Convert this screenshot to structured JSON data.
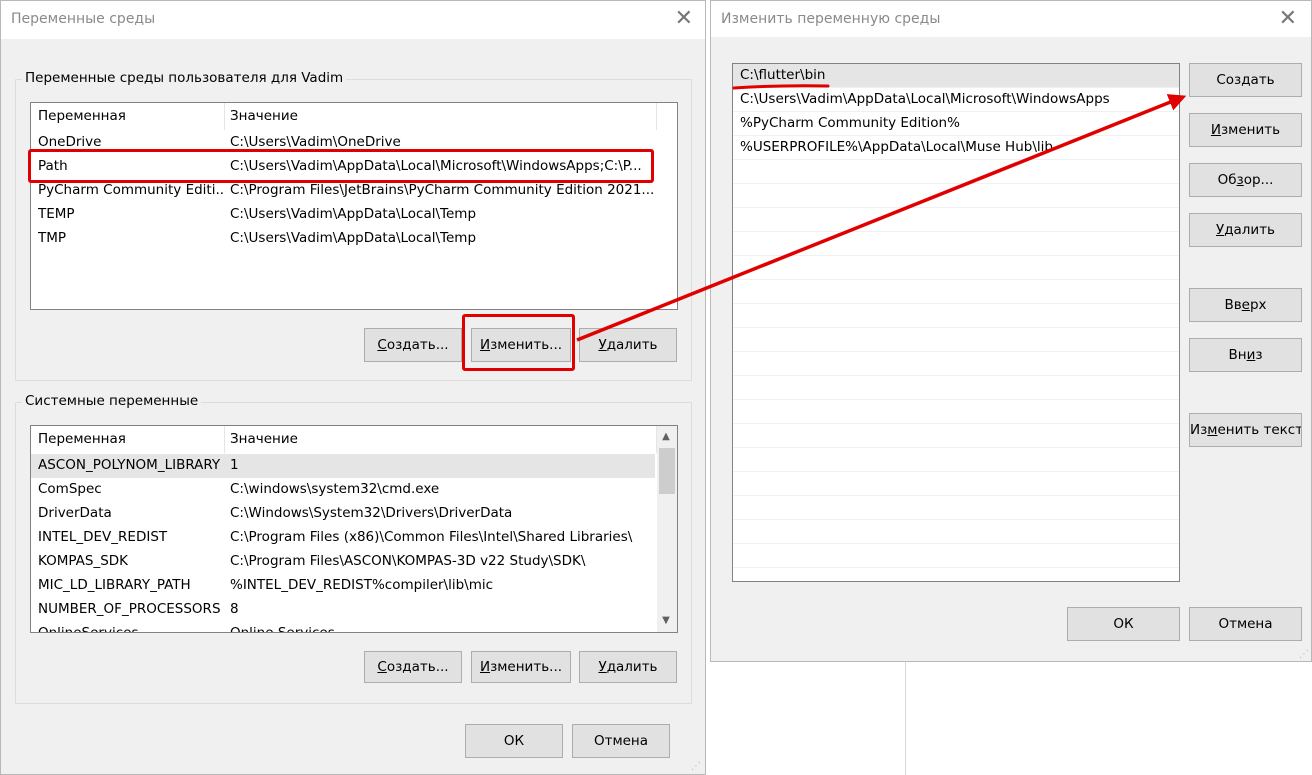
{
  "env_dialog": {
    "title": "Переменные среды",
    "user_group": {
      "legend": "Переменные среды пользователя для Vadim",
      "col_var": "Переменная",
      "col_val": "Значение",
      "rows": [
        {
          "name": "OneDrive",
          "value": "C:\\Users\\Vadim\\OneDrive"
        },
        {
          "name": "Path",
          "value": "C:\\Users\\Vadim\\AppData\\Local\\Microsoft\\WindowsApps;C:\\P..."
        },
        {
          "name": "PyCharm Community Editi...",
          "value": "C:\\Program Files\\JetBrains\\PyCharm Community Edition 2021..."
        },
        {
          "name": "TEMP",
          "value": "C:\\Users\\Vadim\\AppData\\Local\\Temp"
        },
        {
          "name": "TMP",
          "value": "C:\\Users\\Vadim\\AppData\\Local\\Temp"
        }
      ],
      "btn_create_u": "С",
      "btn_create_rest": "оздать...",
      "btn_edit_u": "И",
      "btn_edit_rest": "зменить...",
      "btn_delete_u": "У",
      "btn_delete_rest": "далить"
    },
    "sys_group": {
      "legend": "Системные переменные",
      "col_var": "Переменная",
      "col_val": "Значение",
      "rows": [
        {
          "name": "ASCON_POLYNOM_LIBRARY",
          "value": "1"
        },
        {
          "name": "ComSpec",
          "value": "C:\\windows\\system32\\cmd.exe"
        },
        {
          "name": "DriverData",
          "value": "C:\\Windows\\System32\\Drivers\\DriverData"
        },
        {
          "name": "INTEL_DEV_REDIST",
          "value": "C:\\Program Files (x86)\\Common Files\\Intel\\Shared Libraries\\"
        },
        {
          "name": "KOMPAS_SDK",
          "value": "C:\\Program Files\\ASCON\\KOMPAS-3D v22 Study\\SDK\\"
        },
        {
          "name": "MIC_LD_LIBRARY_PATH",
          "value": "%INTEL_DEV_REDIST%compiler\\lib\\mic"
        },
        {
          "name": "NUMBER_OF_PROCESSORS",
          "value": "8"
        },
        {
          "name": "OnlineServices",
          "value": "Online Services"
        }
      ],
      "btn_create_u": "С",
      "btn_create_rest": "оздать...",
      "btn_edit_u": "И",
      "btn_edit_rest": "зменить...",
      "btn_delete_u": "У",
      "btn_delete_rest": "далить"
    },
    "ok": "ОК",
    "cancel": "Отмена"
  },
  "edit_dialog": {
    "title": "Изменить переменную среды",
    "paths": [
      "C:\\flutter\\bin",
      "C:\\Users\\Vadim\\AppData\\Local\\Microsoft\\WindowsApps",
      "%PyCharm Community Edition%",
      "%USERPROFILE%\\AppData\\Local\\Muse Hub\\lib"
    ],
    "btn_create": "Создать",
    "btn_edit_u": "И",
    "btn_edit_rest": "зменить",
    "btn_browse_pre": "Об",
    "btn_browse_u": "з",
    "btn_browse_rest": "ор...",
    "btn_delete_u": "У",
    "btn_delete_rest": "далить",
    "btn_up_pre": "Вв",
    "btn_up_u": "е",
    "btn_up_rest": "рх",
    "btn_down_pre": "Вн",
    "btn_down_u": "и",
    "btn_down_rest": "з",
    "btn_edittext_pre": "Из",
    "btn_edittext_u": "м",
    "btn_edittext_rest": "енить текст...",
    "ok": "ОК",
    "cancel": "Отмена"
  },
  "annotation_color": "#e00000"
}
